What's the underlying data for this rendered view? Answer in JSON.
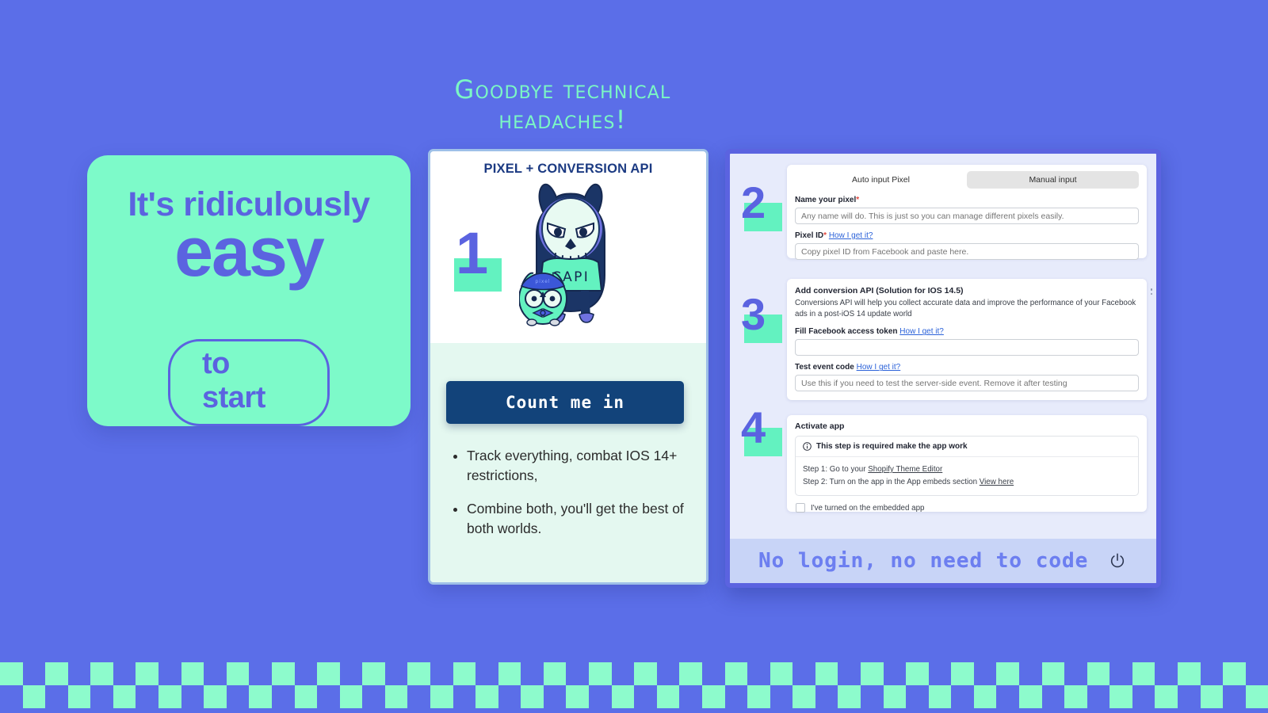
{
  "headline": {
    "line1": "Goodbye technical",
    "line2": "headaches!"
  },
  "green_card": {
    "line1": "It's ridiculously",
    "line2": "easy",
    "pill": "to start"
  },
  "middle_card": {
    "title": "PIXEL + CONVERSION API",
    "step_number": "1",
    "illustration": {
      "big_owl_shirt_text": "CAPI",
      "small_owl_band_text": "pixel",
      "icon_name": "owl-mascot-illustration"
    },
    "cta_button": "Count me in",
    "bullets": [
      "Track everything, combat IOS 14+ restrictions,",
      "Combine both, you'll get the best of both worlds."
    ]
  },
  "app_window": {
    "footer_text": "No login, no need to code",
    "footer_icon": "power-icon",
    "step2": {
      "number": "2",
      "tabs": [
        {
          "label": "Auto input Pixel",
          "selected": false
        },
        {
          "label": "Manual input",
          "selected": true
        }
      ],
      "name_label": "Name your pixel",
      "name_required_mark": "*",
      "name_placeholder": "Any name will do. This is just so you can manage different pixels easily.",
      "pixel_id_label": "Pixel ID",
      "pixel_id_required_mark": "*",
      "pixel_id_help": "How I get it?",
      "pixel_id_placeholder": "Copy pixel ID from Facebook and paste here."
    },
    "step3": {
      "number": "3",
      "title": "Add conversion API (Solution for IOS 14.5)",
      "description": "Conversions API will help you collect accurate data and improve the performance of your Facebook ads in a post-iOS 14 update world",
      "token_label": "Fill Facebook access token",
      "token_help": "How I get it?",
      "token_value": "",
      "test_label": "Test event code",
      "test_help": "How I get it?",
      "test_placeholder": "Use this if you need to test the server-side event. Remove it after testing"
    },
    "step4": {
      "number": "4",
      "title": "Activate app",
      "note_icon": "info-icon",
      "note_title": "This step is required make the app work",
      "note_step1_prefix": "Step 1: Go to your ",
      "note_step1_link": "Shopify Theme Editor",
      "note_step2_prefix": "Step 2: Turn on the app in the App embeds section ",
      "note_step2_link": "View here",
      "checkbox_label": "I've turned on the embedded app",
      "checkbox_checked": false
    }
  },
  "colors": {
    "background_blue": "#5b6ee8",
    "mint": "#7dfac9",
    "accent_indigo": "#5b63e0",
    "navy_button": "#12437a",
    "card_white": "#ffffff",
    "panel_lavender": "#e7ebfb",
    "footer_lavender": "#c8d4f7"
  }
}
